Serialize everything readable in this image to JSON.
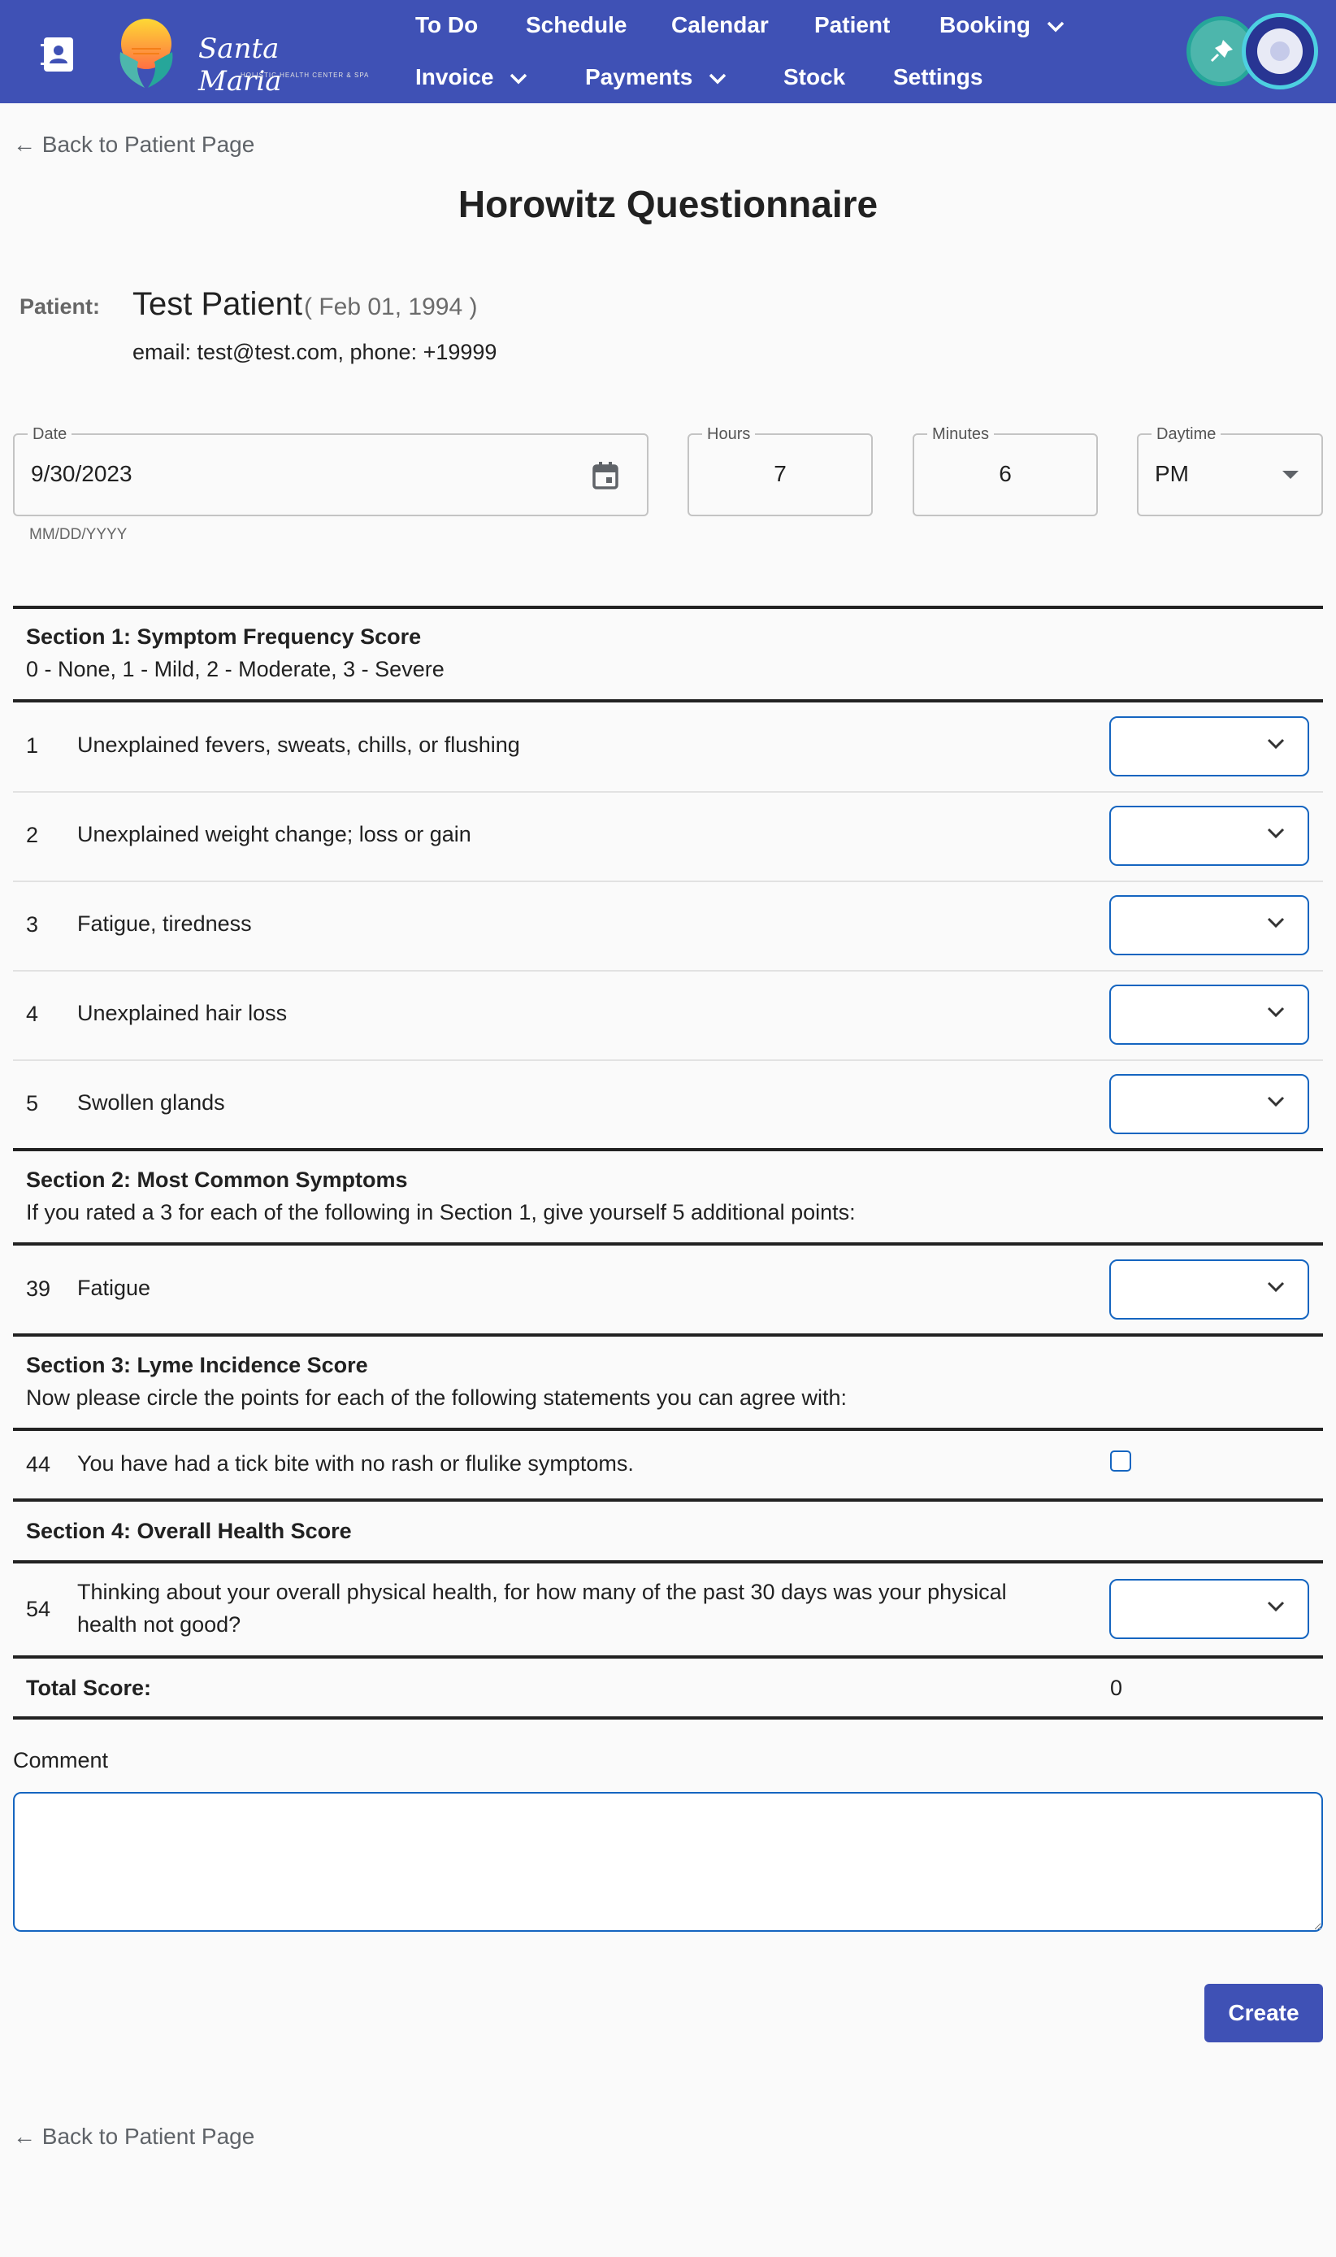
{
  "nav": {
    "logo_text": "Santa Maria",
    "logo_tagline": "HOLISTIC HEALTH CENTER & SPA",
    "items": [
      {
        "label": "To Do"
      },
      {
        "label": "Schedule"
      },
      {
        "label": "Calendar"
      },
      {
        "label": "Patient"
      },
      {
        "label": "Booking"
      },
      {
        "label": "Invoice"
      },
      {
        "label": "Payments"
      },
      {
        "label": "Stock"
      },
      {
        "label": "Settings"
      }
    ]
  },
  "back_link": "← Back to Patient Page",
  "title": "Horowitz Questionnaire",
  "patient": {
    "label": "Patient:",
    "name": "Test Patient",
    "dob": "( Feb 01, 1994 )",
    "contact": "email:  test@test.com,     phone:  +19999"
  },
  "form": {
    "date": {
      "label": "Date",
      "value": "9/30/2023",
      "helper": "MM/DD/YYYY"
    },
    "hours": {
      "label": "Hours",
      "value": "7"
    },
    "minutes": {
      "label": "Minutes",
      "value": "6"
    },
    "daytime": {
      "label": "Daytime",
      "value": "PM"
    }
  },
  "sections": {
    "s1": {
      "title": "Section 1: Symptom Frequency Score",
      "subtitle": "0 - None, 1 - Mild, 2 - Moderate, 3 - Severe",
      "questions": [
        {
          "num": "1",
          "text": "Unexplained fevers, sweats, chills, or flushing"
        },
        {
          "num": "2",
          "text": "Unexplained weight change; loss or gain"
        },
        {
          "num": "3",
          "text": "Fatigue, tiredness"
        },
        {
          "num": "4",
          "text": "Unexplained hair loss"
        },
        {
          "num": "5",
          "text": "Swollen glands"
        }
      ]
    },
    "s2": {
      "title": "Section 2: Most Common Symptoms",
      "subtitle": "If you rated a 3 for each of the following in Section 1, give yourself 5 additional points:",
      "questions": [
        {
          "num": "39",
          "text": "Fatigue"
        }
      ]
    },
    "s3": {
      "title": "Section 3: Lyme Incidence Score",
      "subtitle": "Now please circle the points for each of the following statements you can agree with:",
      "questions": [
        {
          "num": "44",
          "text": "You have had a tick bite with no rash or flulike symptoms."
        }
      ]
    },
    "s4": {
      "title": "Section 4: Overall Health Score",
      "questions": [
        {
          "num": "54",
          "text": "Thinking about your overall physical health, for how many of the past 30 days was your physical health not good?"
        }
      ]
    }
  },
  "total": {
    "label": "Total Score:",
    "value": "0"
  },
  "comment": {
    "label": "Comment",
    "value": ""
  },
  "create_label": "Create",
  "colors": {
    "primary": "#3f51b5",
    "input_border": "#1565c0"
  }
}
